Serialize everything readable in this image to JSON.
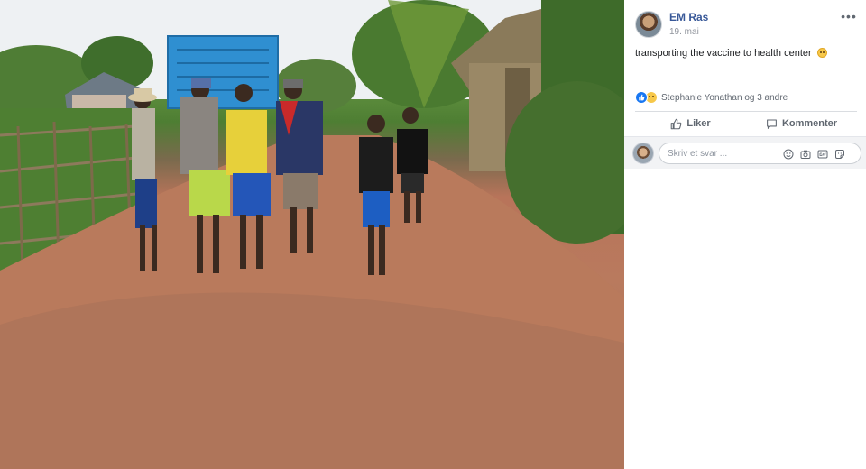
{
  "post": {
    "author": "EM Ras",
    "date": "19. mai",
    "text": "transporting the vaccine to health center",
    "text_emoji": "sad-face-emoji",
    "more_icon": "more-options-icon",
    "reactions": {
      "icons": [
        "like-reaction-icon",
        "sad-reaction-icon"
      ],
      "summary": "Stephanie Yonathan og 3 andre"
    },
    "actions": {
      "like_label": "Liker",
      "comment_label": "Kommenter"
    },
    "comment_box": {
      "placeholder": "Skriv et svar ...",
      "icons": [
        "emoji-icon",
        "camera-icon",
        "gif-icon",
        "sticker-icon"
      ]
    }
  },
  "photo": {
    "description_icon": "post-photo"
  },
  "colors": {
    "author_link": "#385898",
    "like_blue": "#1877f2",
    "muted_text": "#606770",
    "comment_bar_bg": "#f2f3f5"
  }
}
